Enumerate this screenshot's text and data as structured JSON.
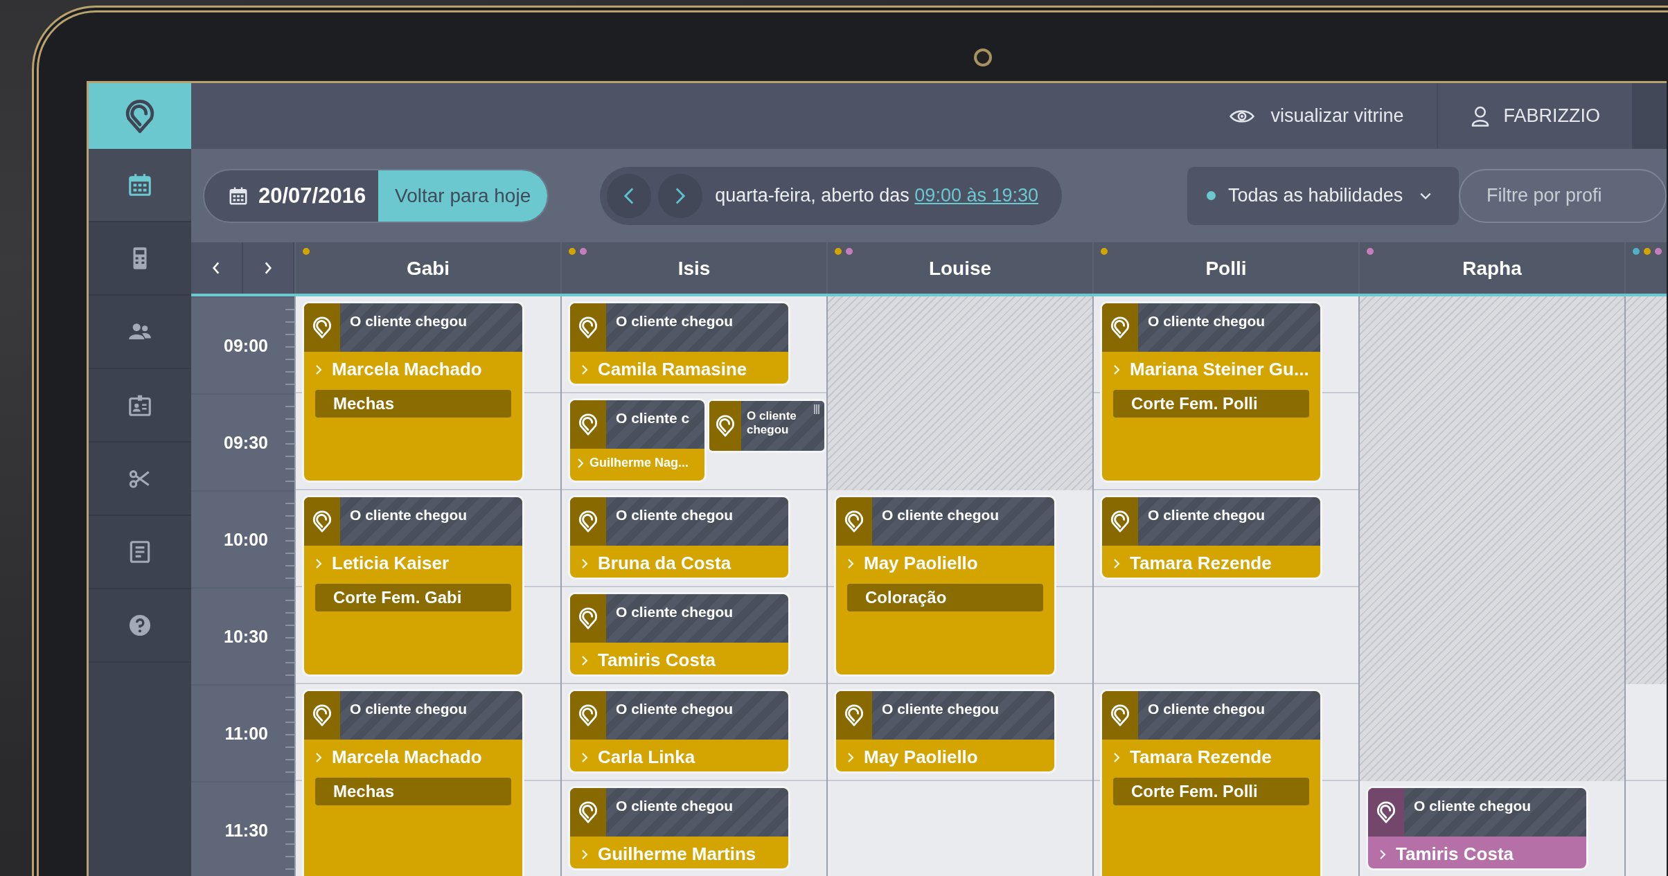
{
  "sidebar": {
    "items": [
      {
        "selected": true
      },
      {
        "selected": false
      },
      {
        "selected": false
      },
      {
        "selected": false
      },
      {
        "selected": false
      },
      {
        "selected": false
      },
      {
        "selected": false
      }
    ]
  },
  "topbar": {
    "showcase_link": "visualizar vitrine",
    "user": "FABRIZZIO"
  },
  "toolbar": {
    "date": "20/07/2016",
    "today_button": "Voltar para hoje",
    "day_info": "quarta-feira, aberto das",
    "hours_link": "09:00 às 19:30",
    "skills_dropdown": "Todas as habilidades",
    "filter": {
      "placeholder": "Filtre por profi"
    }
  },
  "calendar": {
    "times": [
      "09:00",
      "09:30",
      "10:00",
      "10:30",
      "11:00",
      "11:30"
    ],
    "columns": [
      {
        "name": "Gabi",
        "dots": [
          {
            "color": "#d4a500"
          }
        ],
        "slots": [
          {
            "kind": "appointment",
            "color": "#d4a500",
            "status": "O cliente chegou",
            "client": "Marcela Machado",
            "service": "Mechas"
          },
          {
            "kind": "continued"
          },
          {
            "kind": "appointment",
            "color": "#d4a500",
            "status": "O cliente chegou",
            "client": "Leticia Kaiser",
            "service": "Corte Fem. Gabi"
          },
          {
            "kind": "continued"
          },
          {
            "kind": "appointment",
            "color": "#d4a500",
            "status": "O cliente chegou",
            "client": "Marcela Machado",
            "service": "Mechas"
          },
          {
            "kind": "continued"
          }
        ]
      },
      {
        "name": "Isis",
        "dots": [
          {
            "color": "#d4a500"
          },
          {
            "color": "#c77dbb"
          }
        ],
        "slots": [
          {
            "kind": "appointment",
            "color": "#d4a500",
            "status": "O cliente chegou",
            "client": "Camila Ramasine"
          },
          {
            "kind": "appointment",
            "color": "#d4a500",
            "status": "O cliente c",
            "client": "Guilherme Nag...",
            "overlay": {
              "status": "O cliente chegou"
            }
          },
          {
            "kind": "appointment",
            "color": "#d4a500",
            "status": "O cliente chegou",
            "client": "Bruna da Costa"
          },
          {
            "kind": "appointment",
            "color": "#d4a500",
            "status": "O cliente chegou",
            "client": "Tamiris Costa"
          },
          {
            "kind": "appointment",
            "color": "#d4a500",
            "status": "O cliente chegou",
            "client": "Carla Linka"
          },
          {
            "kind": "appointment",
            "color": "#d4a500",
            "status": "O cliente chegou",
            "client": "Guilherme Martins"
          }
        ]
      },
      {
        "name": "Louise",
        "dots": [
          {
            "color": "#d4a500"
          },
          {
            "color": "#c77dbb"
          }
        ],
        "slots": [
          {
            "kind": "blocked"
          },
          {
            "kind": "continued"
          },
          {
            "kind": "appointment",
            "color": "#d4a500",
            "status": "O cliente chegou",
            "client": "May Paoliello",
            "service": "Coloração"
          },
          {
            "kind": "continued"
          },
          {
            "kind": "appointment",
            "color": "#d4a500",
            "status": "O cliente chegou",
            "client": "May Paoliello"
          },
          {
            "kind": "empty"
          }
        ]
      },
      {
        "name": "Polli",
        "dots": [
          {
            "color": "#d4a500"
          }
        ],
        "slots": [
          {
            "kind": "appointment",
            "color": "#d4a500",
            "status": "O cliente chegou",
            "client": "Mariana Steiner Gu...",
            "service": "Corte Fem. Polli"
          },
          {
            "kind": "continued"
          },
          {
            "kind": "appointment",
            "color": "#d4a500",
            "status": "O cliente chegou",
            "client": "Tamara Rezende"
          },
          {
            "kind": "empty"
          },
          {
            "kind": "appointment",
            "color": "#d4a500",
            "status": "O cliente chegou",
            "client": "Tamara Rezende",
            "service": "Corte Fem. Polli"
          },
          {
            "kind": "continued"
          }
        ]
      },
      {
        "name": "Rapha",
        "dots": [
          {
            "color": "#c77dbb"
          }
        ],
        "slots": [
          {
            "kind": "blocked"
          },
          {
            "kind": "continued"
          },
          {
            "kind": "continued"
          },
          {
            "kind": "continued"
          },
          {
            "kind": "continued"
          },
          {
            "kind": "appointment",
            "color": "#b570a8",
            "status": "O cliente chegou",
            "client": "Tamiris Costa"
          }
        ]
      },
      {
        "dots": [
          {
            "color": "#4fb3c4"
          },
          {
            "color": "#d4a500"
          },
          {
            "color": "#c77dbb"
          }
        ],
        "slots": [
          {
            "kind": "blocked"
          },
          {
            "kind": "continued"
          },
          {
            "kind": "continued"
          },
          {
            "kind": "continued"
          },
          {
            "kind": "empty"
          },
          {
            "kind": "empty"
          }
        ]
      }
    ]
  }
}
